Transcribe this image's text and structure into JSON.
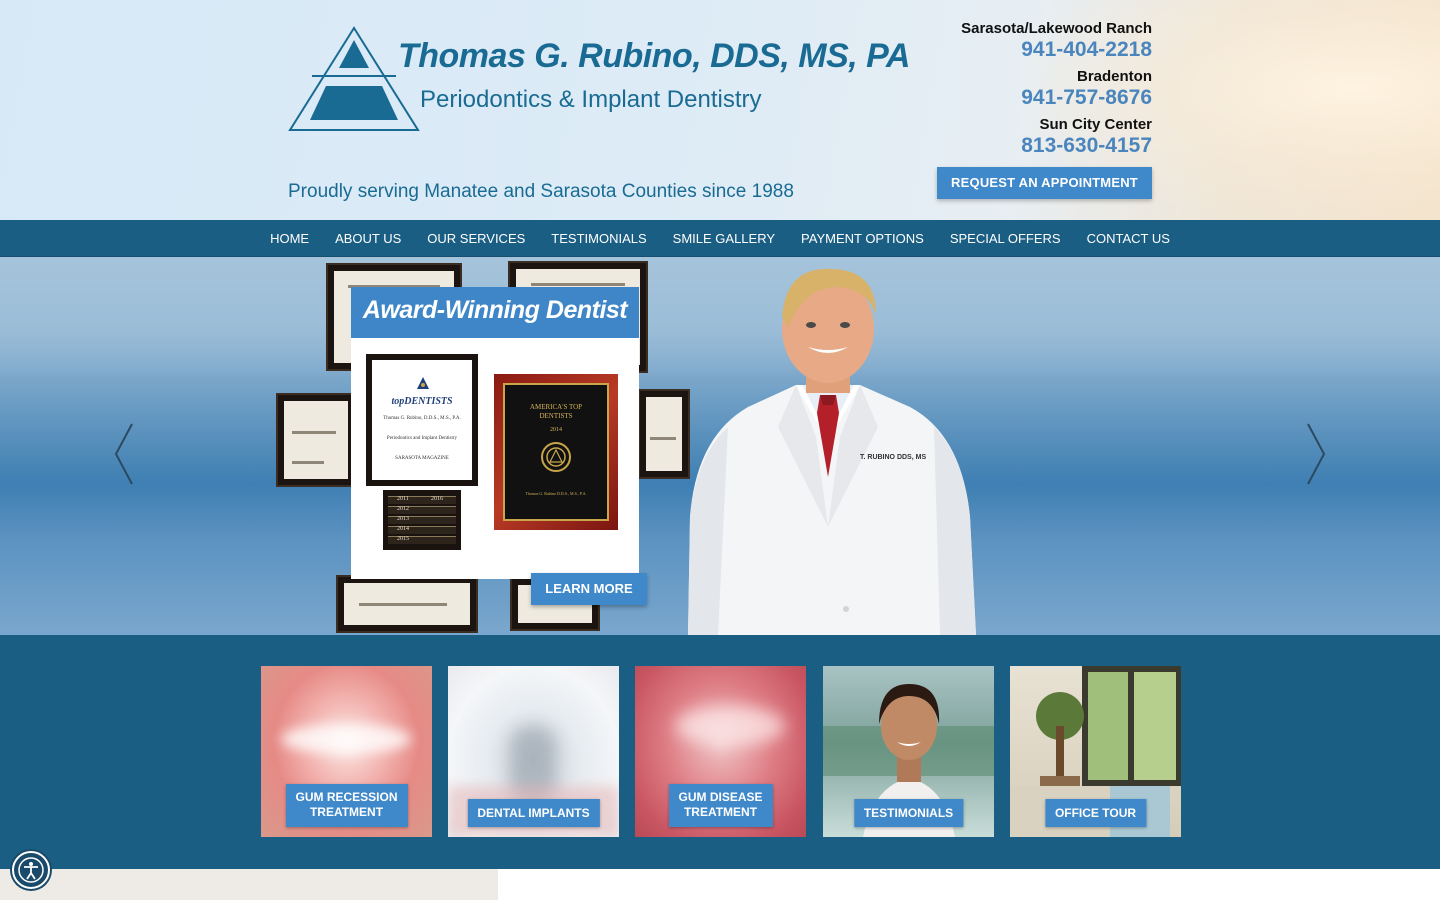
{
  "header": {
    "brand_name": "Thomas G. Rubino, DDS, MS, PA",
    "brand_sub": "Periodontics & Implant Dentistry",
    "tagline": "Proudly serving Manatee and Sarasota Counties since 1988",
    "locations": [
      {
        "name": "Sarasota/Lakewood Ranch",
        "phone": "941-404-2218"
      },
      {
        "name": "Bradenton",
        "phone": "941-757-8676"
      },
      {
        "name": "Sun City Center",
        "phone": "813-630-4157"
      }
    ],
    "request_button": "REQUEST AN APPOINTMENT"
  },
  "nav": {
    "items": [
      "HOME",
      "ABOUT US",
      "OUR SERVICES",
      "TESTIMONIALS",
      "SMILE GALLERY",
      "PAYMENT OPTIONS",
      "SPECIAL OFFERS",
      "CONTACT US"
    ]
  },
  "hero": {
    "slide_title": "Award-Winning Dentist",
    "learn_more": "LEARN MORE",
    "plaque_white": {
      "brand": "topDENTISTS",
      "name": "Thomas G. Rubino, D.D.S., M.S., P.A.",
      "specialty": "Periodontics and Implant Dentistry",
      "magazine": "SARASOTA MAGAZINE"
    },
    "plaque_years": [
      "2011",
      "2016",
      "2012",
      "2013",
      "2014",
      "2015"
    ],
    "plaque_red": {
      "title": "AMERICA'S TOP DENTISTS",
      "year": "2014",
      "name": "Thomas G. Rubino D.D.S., M.S., P.A."
    },
    "coat_tag": "T. RUBINO DDS, MS",
    "prev_icon": "chevron-left-icon",
    "next_icon": "chevron-right-icon"
  },
  "services": [
    {
      "label_line1": "GUM RECESSION",
      "label_line2": "TREATMENT",
      "theme": "smile"
    },
    {
      "label_line1": "DENTAL IMPLANTS",
      "label_line2": "",
      "theme": "implant"
    },
    {
      "label_line1": "GUM DISEASE",
      "label_line2": "TREATMENT",
      "theme": "gums"
    },
    {
      "label_line1": "TESTIMONIALS",
      "label_line2": "",
      "theme": "patient"
    },
    {
      "label_line1": "OFFICE TOUR",
      "label_line2": "",
      "theme": "office"
    }
  ],
  "colors": {
    "brand_blue": "#1a6b93",
    "nav_bg": "#1b5e84",
    "button_blue": "#3f88c9",
    "phone_blue": "#4a86bd"
  },
  "accessibility_icon": "accessibility-icon"
}
